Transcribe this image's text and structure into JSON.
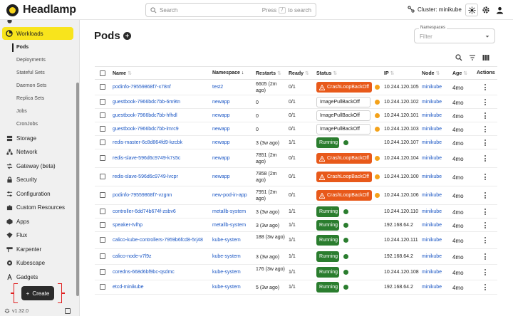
{
  "app": {
    "name": "Headlamp"
  },
  "search": {
    "placeholder": "Search",
    "press": "Press",
    "key": "/",
    "suffix": "to search"
  },
  "cluster": {
    "label": "Cluster: minikube"
  },
  "sidebar": {
    "workloads": "Workloads",
    "subitems": [
      "Pods",
      "Deployments",
      "Stateful Sets",
      "Daemon Sets",
      "Replica Sets",
      "Jobs",
      "CronJobs"
    ],
    "items": [
      "Storage",
      "Network",
      "Gateway (beta)",
      "Security",
      "Configuration",
      "Custom Resources",
      "Apps",
      "Flux",
      "Karpenter",
      "Kubescape",
      "Gadgets"
    ],
    "create": "Create",
    "version": "v1.32.0"
  },
  "page": {
    "title": "Pods",
    "ns_label": "Namespaces",
    "ns_placeholder": "Filter"
  },
  "table": {
    "columns": [
      "Name",
      "Namespace",
      "Restarts",
      "Ready",
      "Status",
      "IP",
      "Node",
      "Age",
      "Actions"
    ],
    "rows": [
      {
        "name": "podinfo-79559868f7-x78nf",
        "namespace": "test2",
        "restarts": "6605 (2m ago)",
        "ready": "0/1",
        "status": "CrashLoopBackOff",
        "status_kind": "crash",
        "ip": "10.244.120.105",
        "node": "minikube",
        "age": "4mo"
      },
      {
        "name": "guestbook-7966bdc7bb-6m9tn",
        "namespace": "newapp",
        "restarts": "0",
        "ready": "0/1",
        "status": "ImagePullBackOff",
        "status_kind": "pull",
        "ip": "10.244.120.102",
        "node": "minikube",
        "age": "4mo"
      },
      {
        "name": "guestbook-7966bdc7bb-hfhdl",
        "namespace": "newapp",
        "restarts": "0",
        "ready": "0/1",
        "status": "ImagePullBackOff",
        "status_kind": "pull",
        "ip": "10.244.120.101",
        "node": "minikube",
        "age": "4mo"
      },
      {
        "name": "guestbook-7966bdc7bb-lmrc9",
        "namespace": "newapp",
        "restarts": "0",
        "ready": "0/1",
        "status": "ImagePullBackOff",
        "status_kind": "pull",
        "ip": "10.244.120.103",
        "node": "minikube",
        "age": "4mo"
      },
      {
        "name": "redis-master-6c8d864fd9-kzcbk",
        "namespace": "newapp",
        "restarts": "3 (3w ago)",
        "ready": "1/1",
        "status": "Running",
        "status_kind": "run",
        "ip": "10.244.120.107",
        "node": "minikube",
        "age": "4mo"
      },
      {
        "name": "redis-slave-596d6c9749-k7s5c",
        "namespace": "newapp",
        "restarts": "7851 (2m ago)",
        "ready": "0/1",
        "status": "CrashLoopBackOff",
        "status_kind": "crash",
        "ip": "10.244.120.104",
        "node": "minikube",
        "age": "4mo"
      },
      {
        "name": "redis-slave-596d6c9749-lvcpr",
        "namespace": "newapp",
        "restarts": "7858 (2m ago)",
        "ready": "0/1",
        "status": "CrashLoopBackOff",
        "status_kind": "crash",
        "ip": "10.244.120.100",
        "node": "minikube",
        "age": "4mo"
      },
      {
        "name": "podinfo-79559868f7-vzgnn",
        "namespace": "new-pod-in-app",
        "restarts": "7951 (2m ago)",
        "ready": "0/1",
        "status": "CrashLoopBackOff",
        "status_kind": "crash",
        "ip": "10.244.120.106",
        "node": "minikube",
        "age": "4mo"
      },
      {
        "name": "controller-6dd74b674f-zsbv6",
        "namespace": "metallb-system",
        "restarts": "3 (3w ago)",
        "ready": "1/1",
        "status": "Running",
        "status_kind": "run",
        "ip": "10.244.120.110",
        "node": "minikube",
        "age": "4mo"
      },
      {
        "name": "speaker-tvlhp",
        "namespace": "metallb-system",
        "restarts": "3 (3w ago)",
        "ready": "1/1",
        "status": "Running",
        "status_kind": "run",
        "ip": "192.168.64.2",
        "node": "minikube",
        "age": "4mo"
      },
      {
        "name": "calico-kube-controllers-7959b6fcd8-5rj48",
        "namespace": "kube-system",
        "restarts": "188 (3w ago)",
        "ready": "1/1",
        "status": "Running",
        "status_kind": "run",
        "ip": "10.244.120.111",
        "node": "minikube",
        "age": "4mo"
      },
      {
        "name": "calico-node-v7l9z",
        "namespace": "kube-system",
        "restarts": "3 (3w ago)",
        "ready": "1/1",
        "status": "Running",
        "status_kind": "run",
        "ip": "192.168.64.2",
        "node": "minikube",
        "age": "4mo"
      },
      {
        "name": "coredns-668d6bf9bc-qsdmc",
        "namespace": "kube-system",
        "restarts": "176 (3w ago)",
        "ready": "1/1",
        "status": "Running",
        "status_kind": "run",
        "ip": "10.244.120.108",
        "node": "minikube",
        "age": "4mo"
      },
      {
        "name": "etcd-minikube",
        "namespace": "kube-system",
        "restarts": "5 (3w ago)",
        "ready": "1/1",
        "status": "Running",
        "status_kind": "run",
        "ip": "192.168.64.2",
        "node": "minikube",
        "age": "4mo"
      }
    ]
  },
  "colors": {
    "accent": "#f8e41c",
    "crash": "#e8591a",
    "running": "#2a7d2e",
    "link": "#1a56c4",
    "warning_dot": "#f4a21a"
  }
}
